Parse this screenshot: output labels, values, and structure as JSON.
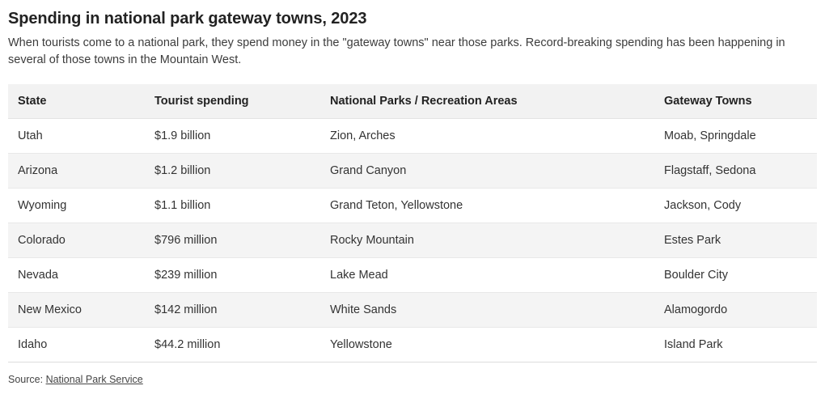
{
  "header": {
    "title": "Spending in national park gateway towns, 2023",
    "subtitle": "When tourists come to a national park, they spend money in the \"gateway towns\" near those parks. Record-breaking spending has been happening in several of those towns in the Mountain West."
  },
  "table": {
    "columns": [
      "State",
      "Tourist spending",
      "National Parks / Recreation Areas",
      "Gateway Towns"
    ],
    "rows": [
      {
        "state": "Utah",
        "spending": "$1.9 billion",
        "parks": "Zion, Arches",
        "towns": "Moab, Springdale"
      },
      {
        "state": "Arizona",
        "spending": "$1.2 billion",
        "parks": "Grand Canyon",
        "towns": "Flagstaff, Sedona"
      },
      {
        "state": "Wyoming",
        "spending": "$1.1 billion",
        "parks": "Grand Teton, Yellowstone",
        "towns": "Jackson, Cody"
      },
      {
        "state": "Colorado",
        "spending": "$796 million",
        "parks": "Rocky Mountain",
        "towns": "Estes Park"
      },
      {
        "state": "Nevada",
        "spending": "$239 million",
        "parks": "Lake Mead",
        "towns": "Boulder City"
      },
      {
        "state": "New Mexico",
        "spending": "$142 million",
        "parks": "White Sands",
        "towns": "Alamogordo"
      },
      {
        "state": "Idaho",
        "spending": "$44.2 million",
        "parks": "Yellowstone",
        "towns": "Island Park"
      }
    ]
  },
  "footer": {
    "source_prefix": "Source: ",
    "source_link": "National Park Service"
  },
  "colors": {
    "header_band": "#f2f2f2",
    "row_alt": "#f4f4f4",
    "row_base": "#ffffff",
    "text": "#333333",
    "title_text": "#222222",
    "border": "#e8e8e8"
  }
}
